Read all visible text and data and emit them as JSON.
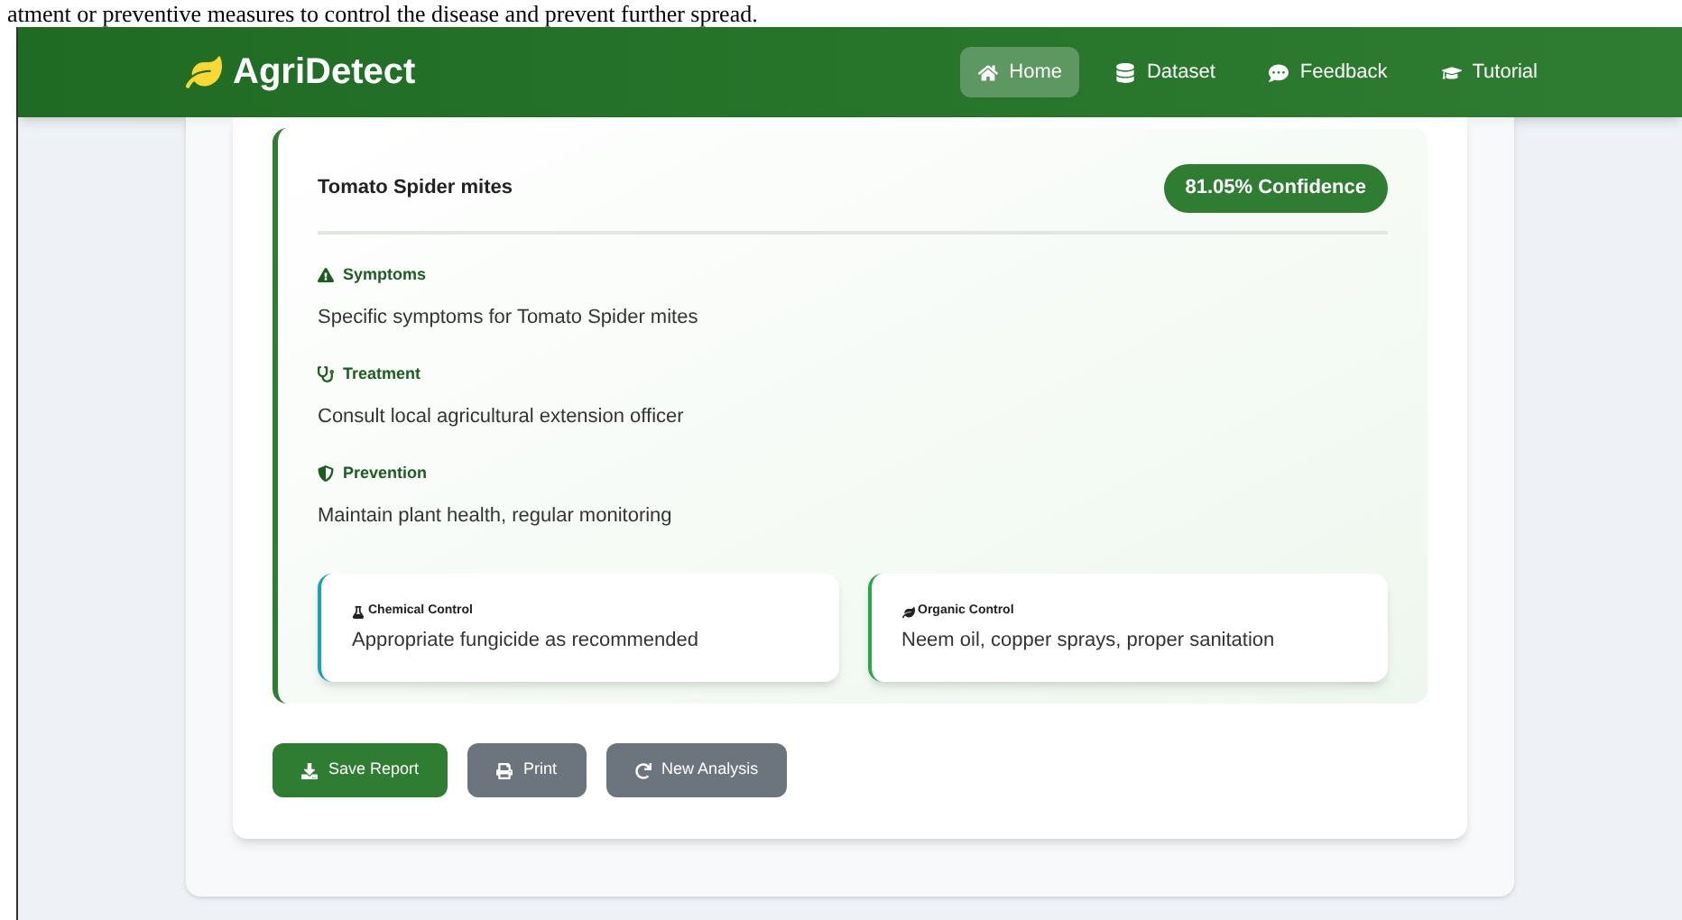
{
  "document_text": "atment or preventive measures to control the disease and prevent further spread.",
  "brand": "AgriDetect",
  "nav": [
    {
      "label": "Home",
      "selected": true
    },
    {
      "label": "Dataset",
      "selected": false
    },
    {
      "label": "Feedback",
      "selected": false
    },
    {
      "label": "Tutorial",
      "selected": false
    }
  ],
  "result": {
    "disease": "Tomato Spider mites",
    "confidence": "81.05% Confidence",
    "sections": [
      {
        "title": "Symptoms",
        "text": "Specific symptoms for Tomato Spider mites"
      },
      {
        "title": "Treatment",
        "text": "Consult local agricultural extension officer"
      },
      {
        "title": "Prevention",
        "text": "Maintain plant health, regular monitoring"
      }
    ],
    "controls": [
      {
        "color": "#17a2b8",
        "title": "Chemical Control",
        "text": "Appropriate fungicide as recommended"
      },
      {
        "color": "#28a745",
        "title": "Organic Control",
        "text": "Neem oil, copper sprays, proper sanitation"
      }
    ]
  },
  "actions": [
    {
      "label": "Save Report",
      "kind": "primary"
    },
    {
      "label": "Print",
      "kind": "secondary"
    },
    {
      "label": "New Analysis",
      "kind": "secondary"
    }
  ]
}
